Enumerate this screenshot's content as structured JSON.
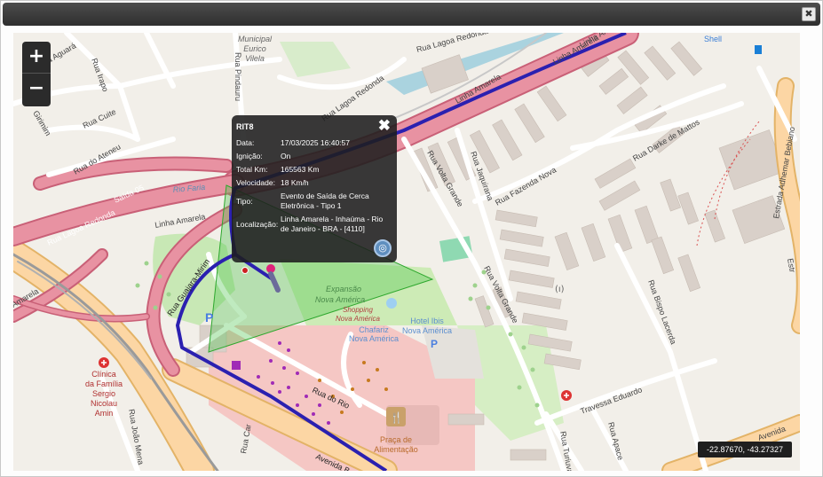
{
  "window": {
    "close_label": "✖"
  },
  "map": {
    "zoom_in_label": "+",
    "zoom_out_label": "−",
    "coordinates_readout": "-22.87670, -43.27327",
    "labels": {
      "rua_aguara": "Rua Aguará",
      "rua_irapo": "Rua Irapo",
      "girimim": "Girimim",
      "rua_cuite": "Rua Cuite",
      "rua_do_ateneu": "Rua do Ateneu",
      "municipal_1": "Municipal",
      "municipal_2": "Eurico",
      "municipal_3": "Vilela",
      "rua_pindauru": "Rua Pindauru",
      "rua_lagoa_redonda_top": "Rua Lagoa Redonda",
      "rua_lagoa_redonda": "Rua Lagoa Redonda",
      "rua_lagoa_redonda_left": "Rua Lagoa Redonda",
      "saida_05": "Saída 05",
      "rio_farias": "Rio Faria",
      "linha_amarela_1": "Linha Amarela",
      "linha_amarela_2": "Linha Amarela",
      "linha_amarela_3": "Linha Amarela",
      "linha_amarela_4": "Linha Amarela",
      "amarela_left": "Amarela",
      "rua_guajara_mirim": "Rua Guajara-Mirim",
      "shell": "Shell",
      "rua_darke_de_mattos": "Rua Darke de Mattos",
      "rua_fazenda_nova": "Rua Fazenda Nova",
      "rua_jaquirana": "Rua Jaquirana",
      "rua_volta_grande_1": "Rua Volta Grande",
      "rua_volta_grande_2": "Rua Volta Grande",
      "rua_bispo_lacerda": "Rua Bispo Lacerda",
      "estrada_adhemar": "Estrada Adhemar Bebiano",
      "estr": "Estr",
      "expansao_1": "Expansão",
      "expansao_2": "Nova América",
      "shopping_1": "Shopping",
      "shopping_2": "Nova América",
      "chafariz_1": "Chafariz",
      "chafariz_2": "Nova América",
      "hotel_1": "Hotel Ibis",
      "hotel_2": "Nova América",
      "rua_do_rio": "Rua do Rio",
      "praca_1": "Praça de",
      "praca_2": "Alimentação",
      "travessa_eduardo": "Travessa Eduardo",
      "clinica_1": "Clínica",
      "clinica_2": "da Família",
      "clinica_3": "Sergio",
      "clinica_4": "Nicolau",
      "clinica_5": "Amin",
      "rua_joao_mena": "Rua João Mena",
      "rua_car": "Rua Car",
      "avenida_b": "Avenida B",
      "avenida_right": "Avenida",
      "rua_turiuva": "Rua Turiuva",
      "rua_apace": "Rua Apace"
    }
  },
  "popup": {
    "title": "RIT8",
    "close_label": "✖",
    "rows": [
      {
        "key": "Data:",
        "value": "17/03/2025 16:40:57"
      },
      {
        "key": "Ignição:",
        "value": "On"
      },
      {
        "key": "Total Km:",
        "value": "165563 Km"
      },
      {
        "key": "Velocidade:",
        "value": "18 Km/h"
      },
      {
        "key": "Tipo:",
        "value": "Evento de Saída de Cerca Eletrônica - Tipo 1"
      },
      {
        "key": "Localização:",
        "value": "Linha Amarela - Inhaúma - Rio de Janeiro - BRA - [4110]"
      }
    ],
    "nav_icon": "compass-icon"
  },
  "colors": {
    "highway": "#e892a2",
    "motorway_casing": "#d4677d",
    "trunk": "#f9d99a",
    "route": "#2b20b0",
    "geofence": "#47c247",
    "building": "#d9d0c9",
    "park": "#c8e8b5",
    "mall": "#f5c7c4"
  }
}
